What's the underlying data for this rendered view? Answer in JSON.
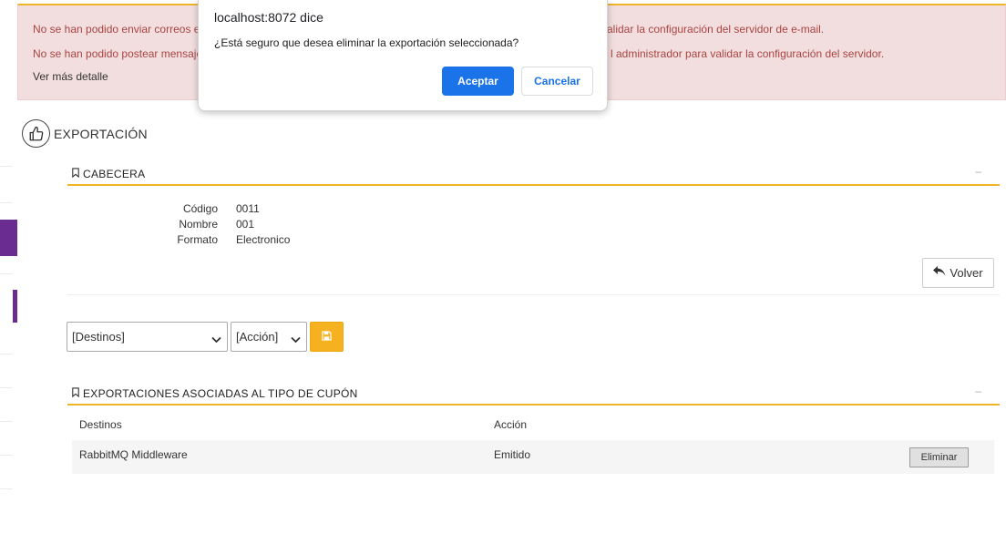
{
  "alert": {
    "line1": "No se han podido enviar correos e",
    "line1_right": "alidar la configuración del servidor de e-mail.",
    "line2": "No se han podido postear mensaje",
    "line2_right": "l administrador para validar la configuración del servidor.",
    "more": "Ver más detalle"
  },
  "dialog": {
    "title": "localhost:8072 dice",
    "message": "¿Está seguro que desea eliminar la exportación seleccionada?",
    "ok_label": "Aceptar",
    "cancel_label": "Cancelar"
  },
  "page": {
    "title": "EXPORTACIÓN",
    "icon": "thumbs-up-icon"
  },
  "header_section": {
    "title": "CABECERA",
    "minimize": "–",
    "fields": [
      {
        "label": "Código",
        "value": "0011"
      },
      {
        "label": "Nombre",
        "value": "001"
      },
      {
        "label": "Formato",
        "value": "Electronico"
      }
    ],
    "back_label": "Volver"
  },
  "form": {
    "destinos_selected": "[Destinos]",
    "accion_selected": "[Acción]",
    "save_icon": "floppy-disk-icon"
  },
  "exports_section": {
    "title": "EXPORTACIONES ASOCIADAS AL TIPO DE CUPÓN",
    "minimize": "–",
    "columns": [
      "Destinos",
      "Acción"
    ],
    "rows": [
      {
        "destino": "RabbitMQ Middleware",
        "accion": "Emitido",
        "delete_label": "Eliminar"
      }
    ]
  },
  "colors": {
    "accent": "#f0b429",
    "primary_blue": "#1a73e8",
    "alert_bg": "#f2dede",
    "alert_text": "#a94442",
    "sidebar_purple": "#6a2c91"
  }
}
